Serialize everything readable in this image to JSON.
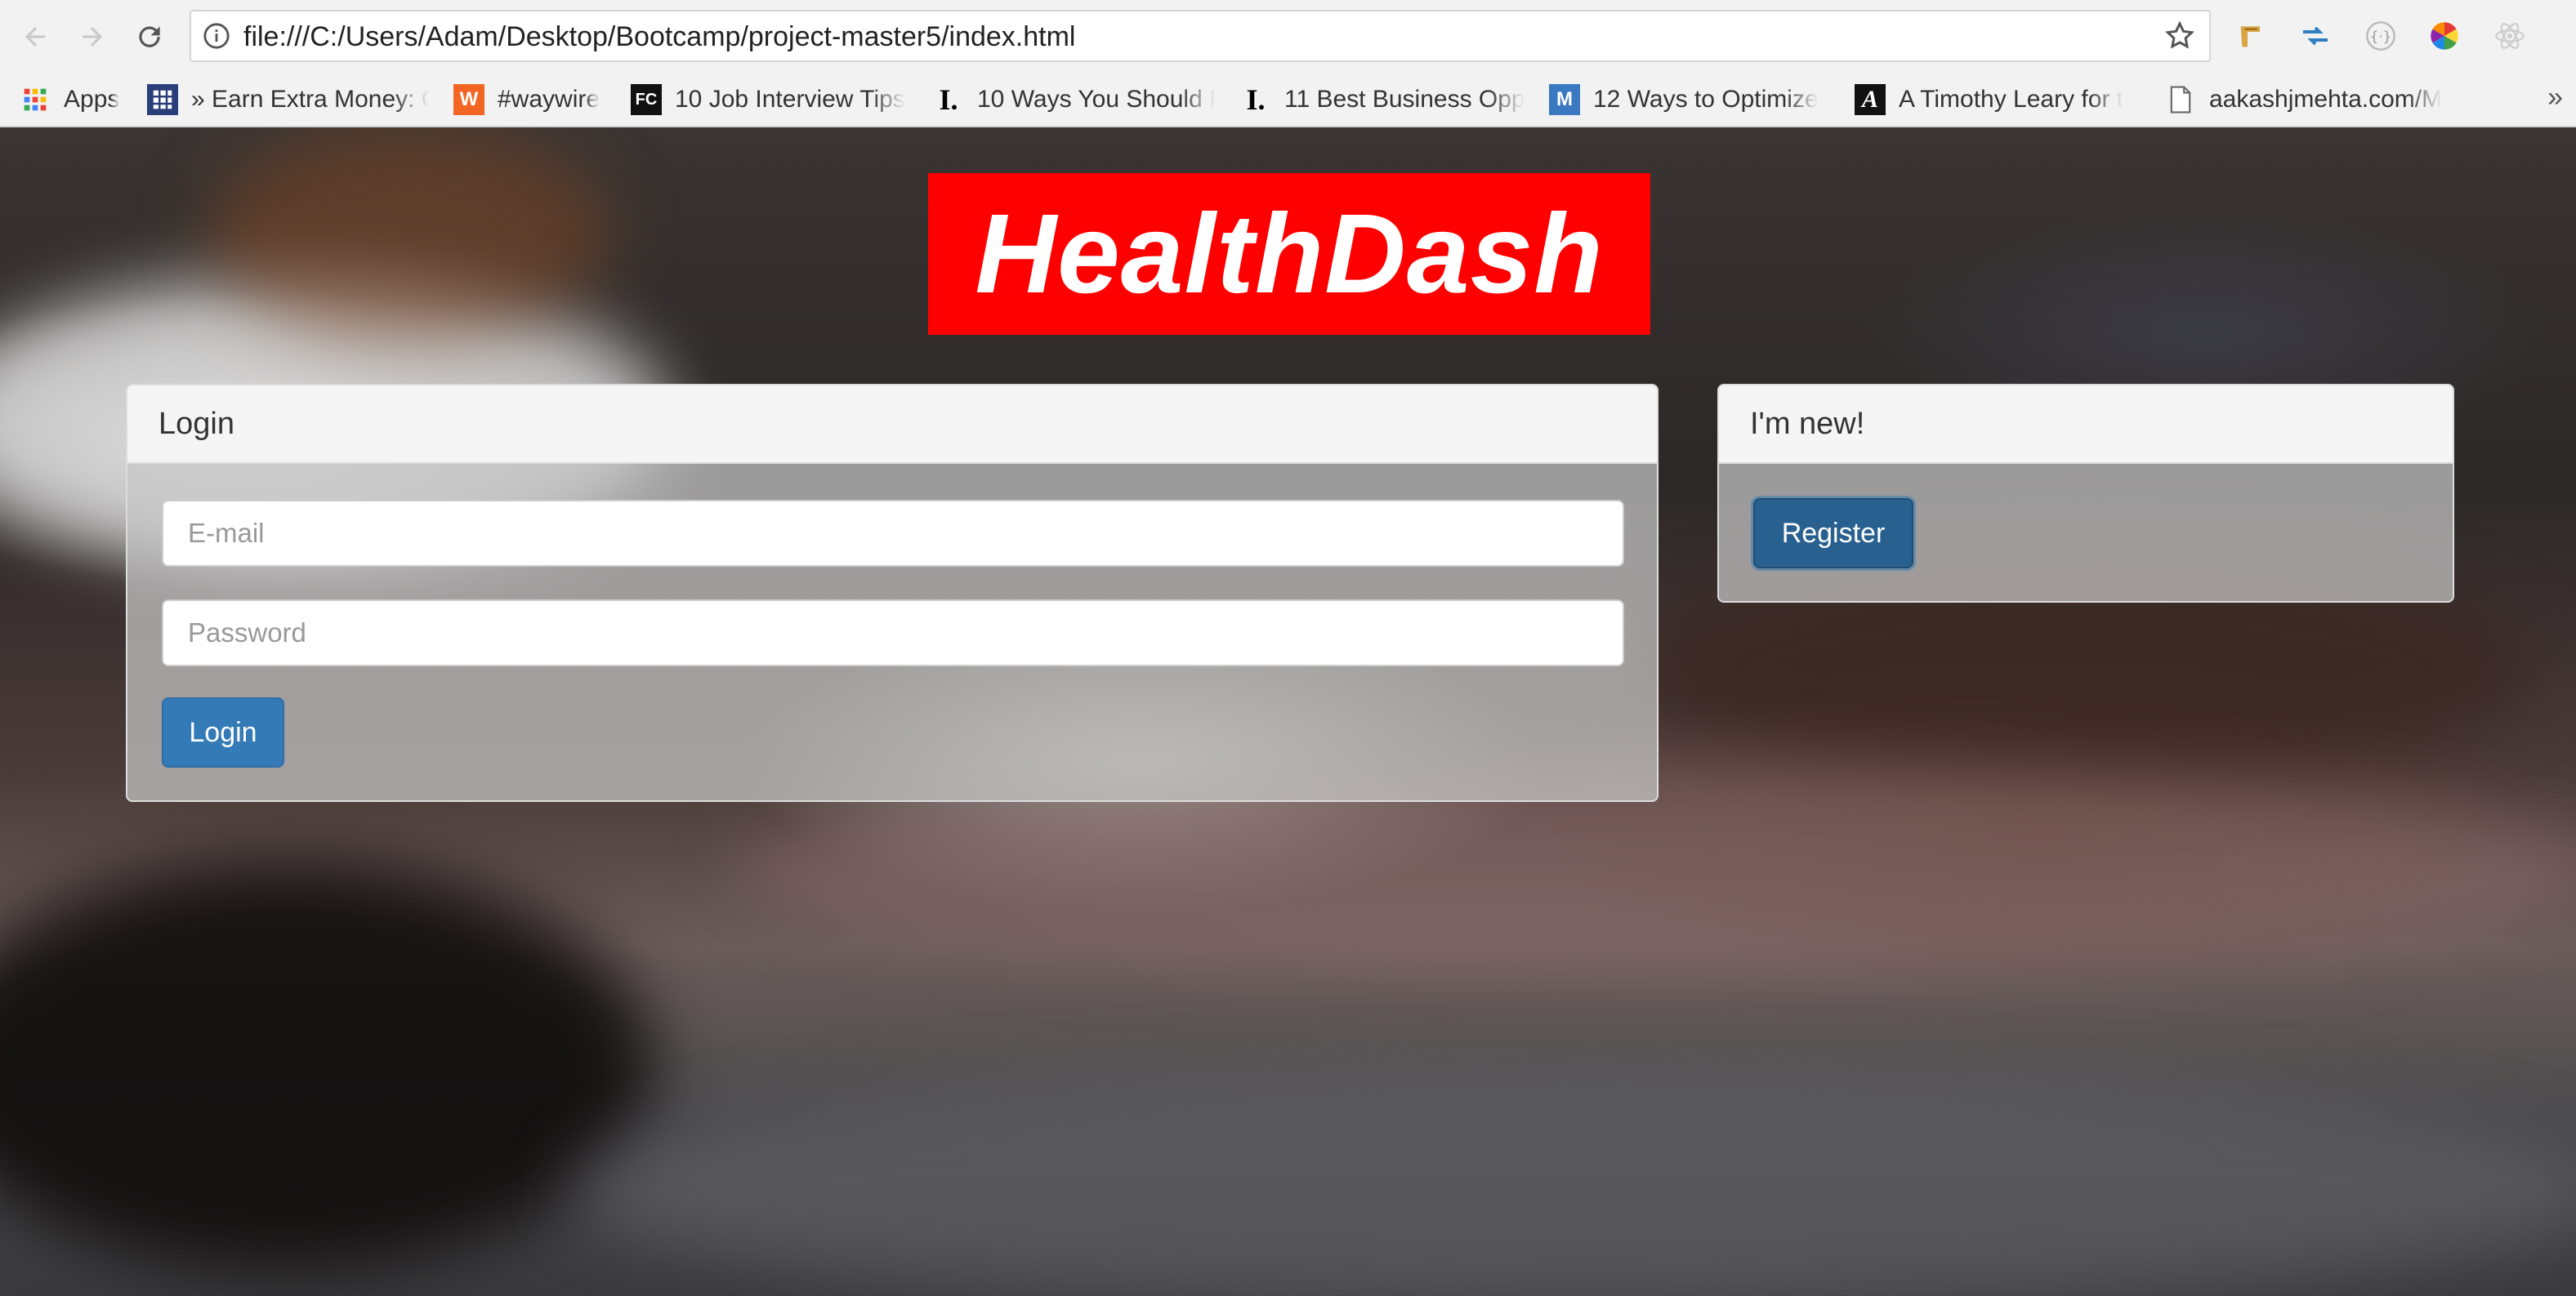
{
  "browser": {
    "url": "file:///C:/Users/Adam/Desktop/Bootcamp/project-master5/index.html",
    "bookmarks": [
      {
        "label": "Apps",
        "icon": "apps-grid-icon"
      },
      {
        "label": "» Earn Extra Money: C",
        "icon": "grid-favicon-icon"
      },
      {
        "label": "#waywire",
        "icon": "waywire-favicon-icon"
      },
      {
        "label": "10 Job Interview Tips",
        "icon": "fastcompany-favicon-icon"
      },
      {
        "label": "10 Ways You Should I",
        "icon": "inc-favicon-icon"
      },
      {
        "label": "11 Best Business Opp",
        "icon": "inc-favicon-icon"
      },
      {
        "label": "12 Ways to Optimize",
        "icon": "m-favicon-icon"
      },
      {
        "label": "A Timothy Leary for t",
        "icon": "atlantic-favicon-icon"
      },
      {
        "label": "aakashjmehta.com/M",
        "icon": "page-icon"
      }
    ],
    "overflow": "»"
  },
  "logo": {
    "text": "HealthDash",
    "bg": "#ff0000"
  },
  "login_panel": {
    "title": "Login",
    "email_placeholder": "E-mail",
    "password_placeholder": "Password",
    "button": "Login"
  },
  "register_panel": {
    "title": "I'm new!",
    "button": "Register"
  },
  "colors": {
    "primary": "#337ab7",
    "primary_dark": "#286090",
    "logo_red": "#ff0000"
  }
}
